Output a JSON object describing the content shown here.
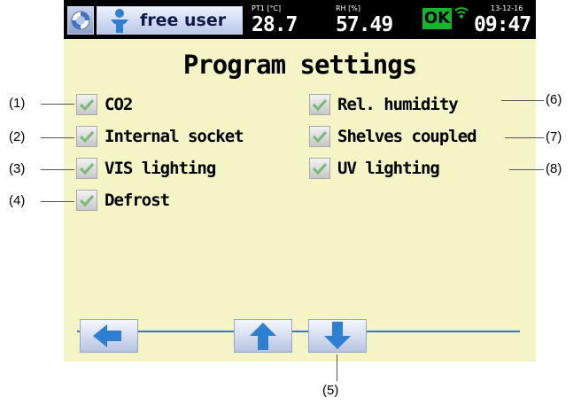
{
  "status_bar": {
    "user_label": "free user",
    "temperature": {
      "caption": "PT1 [°C]",
      "value": "28.7"
    },
    "humidity": {
      "caption": "RH [%]",
      "value": "57.49"
    },
    "status_ok": "OK",
    "date": "13-12-16",
    "time": "09:47"
  },
  "page_title": "Program settings",
  "options": [
    {
      "label": "CO2",
      "checked": true
    },
    {
      "label": "Internal socket",
      "checked": true
    },
    {
      "label": "VIS lighting",
      "checked": true
    },
    {
      "label": "Defrost",
      "checked": true
    },
    {
      "label": "Rel. humidity",
      "checked": true
    },
    {
      "label": "Shelves coupled",
      "checked": true
    },
    {
      "label": "UV lighting",
      "checked": true
    }
  ],
  "callouts": [
    "(1)",
    "(2)",
    "(3)",
    "(4)",
    "(5)",
    "(6)",
    "(7)",
    "(8)"
  ],
  "icons": {
    "logo": "lifebuoy-icon",
    "user": "user-icon",
    "wifi": "wifi-icon",
    "check": "checkmark-icon",
    "back": "arrow-left-icon",
    "up": "arrow-up-icon",
    "down": "arrow-down-icon"
  },
  "colors": {
    "screen_bg": "#f4f4c6",
    "status_bar_bg": "#000000",
    "ok_green": "#16b52d",
    "arrow_blue": "#2f7fd0",
    "check_green": "#78b878"
  }
}
